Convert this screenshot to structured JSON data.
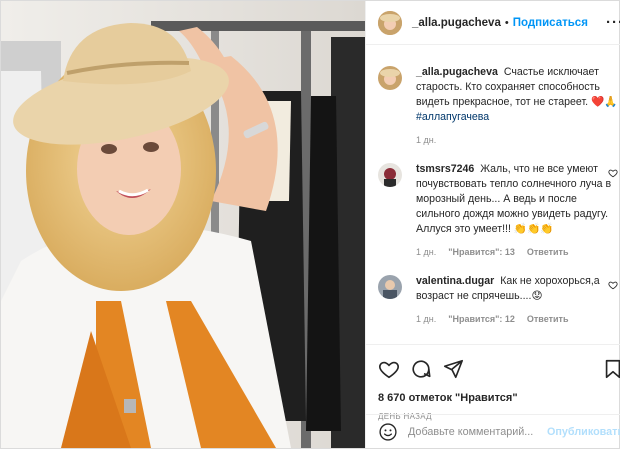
{
  "post": {
    "username": "_alla.pugacheva",
    "separator": "•",
    "follow_label": "Подписаться",
    "more_label": "···"
  },
  "caption": {
    "username": "_alla.pugacheva",
    "text": "Счастье исключает старость. Кто сохраняет способность видеть прекрасное, тот не стареет.",
    "emoji": "❤️🙏",
    "hashtag": "#аллапугачева",
    "time": "1 дн."
  },
  "comments": [
    {
      "username": "tsmsrs7246",
      "text": "Жаль, что не все умеют почувствовать тепло солнечного луча в морозный день... А ведь и после сильного дождя можно увидеть радугу. Аллуся это умеет!!! 👏👏👏",
      "time": "1 дн.",
      "likes": "\"Нравится\": 13",
      "reply": "Ответить"
    },
    {
      "username": "valentina.dugar",
      "text": "Как не хорохорься,а возраст не спрячешь....😟",
      "time": "1 дн.",
      "likes": "\"Нравится\": 12",
      "reply": "Ответить"
    }
  ],
  "actions": {
    "like_icon": "heart-icon",
    "comment_icon": "comment-icon",
    "share_icon": "send-icon",
    "save_icon": "bookmark-icon"
  },
  "likes_count": "8 670 отметок \"Нравится\"",
  "posted_time": "ДЕНЬ НАЗАД",
  "add_comment": {
    "placeholder": "Добавьте комментарий...",
    "publish_label": "Опубликовать"
  },
  "colors": {
    "accent": "#0095f6",
    "publish_disabled": "#b2dffc",
    "muted": "#8e8e8e",
    "hashtag": "#00376b",
    "border": "#dbdbdb"
  }
}
